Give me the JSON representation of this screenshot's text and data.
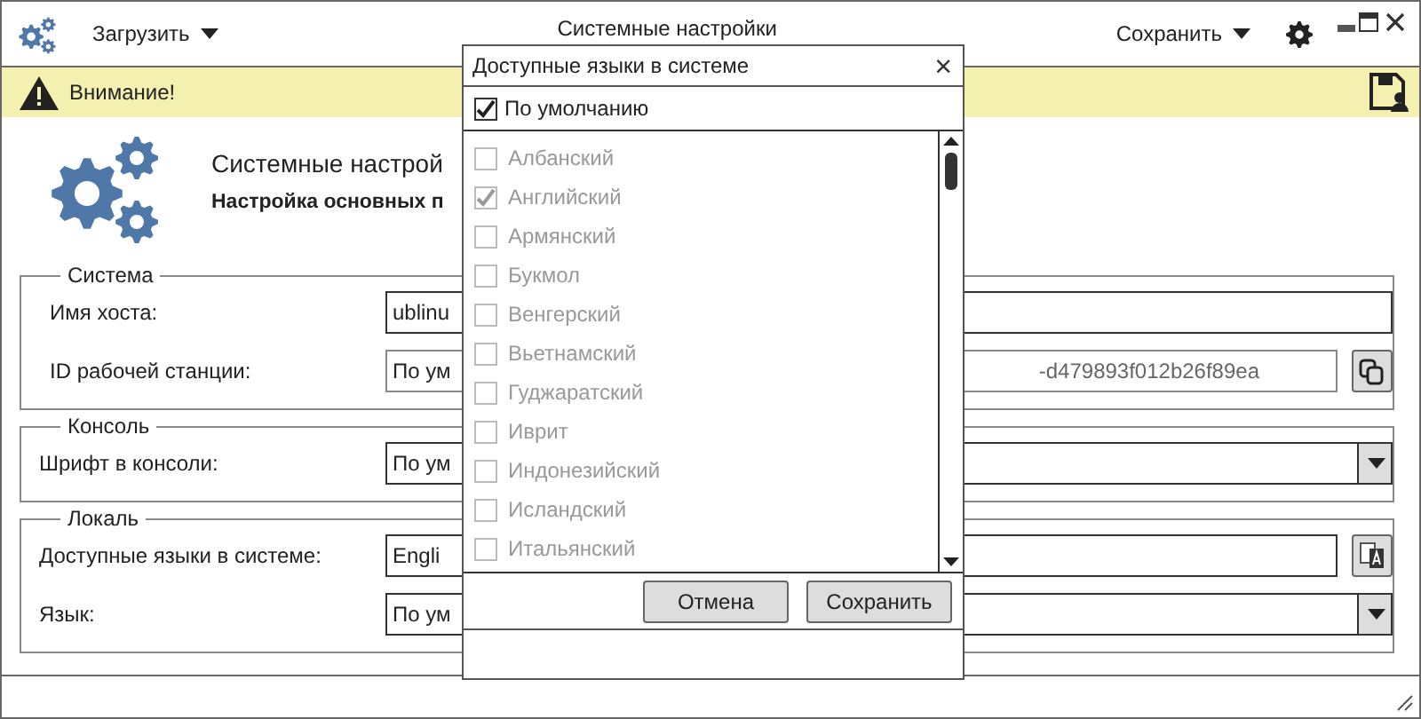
{
  "window": {
    "title": "Системные настройки",
    "menus": [
      "Загрузить",
      "Сохранить"
    ]
  },
  "warning": {
    "text": "Внимание!"
  },
  "header": {
    "title": "Системные настрой",
    "subtitle": "Настройка основных п"
  },
  "groups": [
    {
      "title": "Система",
      "rows": [
        {
          "kind": "text",
          "label": "Имя хоста:",
          "value": "ublinu"
        },
        {
          "kind": "copy",
          "label": "ID рабочей станции:",
          "value": "По ум",
          "value_tail": "-d479893f012b26f89ea"
        }
      ]
    },
    {
      "title": "Консоль",
      "rows": [
        {
          "kind": "select",
          "label": "Шрифт в консоли:",
          "value": "По ум"
        }
      ]
    },
    {
      "title": "Локаль",
      "rows": [
        {
          "kind": "translate",
          "label": "Доступные языки в системе:",
          "value": "Engli"
        },
        {
          "kind": "select",
          "label": "Язык:",
          "value": "По ум"
        }
      ]
    }
  ],
  "dialog": {
    "title": "Доступные языки в системе",
    "close": "×",
    "default_option": {
      "label": "По умолчанию",
      "checked": true
    },
    "languages": [
      {
        "label": "Албанский",
        "checked": false,
        "disabled": true
      },
      {
        "label": "Английский",
        "checked": true,
        "disabled": true
      },
      {
        "label": "Армянский",
        "checked": false,
        "disabled": true
      },
      {
        "label": "Букмол",
        "checked": false,
        "disabled": true
      },
      {
        "label": "Венгерский",
        "checked": false,
        "disabled": true
      },
      {
        "label": "Вьетнамский",
        "checked": false,
        "disabled": true
      },
      {
        "label": "Гуджаратский",
        "checked": false,
        "disabled": true
      },
      {
        "label": "Иврит",
        "checked": false,
        "disabled": true
      },
      {
        "label": "Индонезийский",
        "checked": false,
        "disabled": true
      },
      {
        "label": "Исландский",
        "checked": false,
        "disabled": true
      },
      {
        "label": "Итальянский",
        "checked": false,
        "disabled": true
      }
    ],
    "buttons": [
      "Отмена",
      "Сохранить"
    ]
  }
}
